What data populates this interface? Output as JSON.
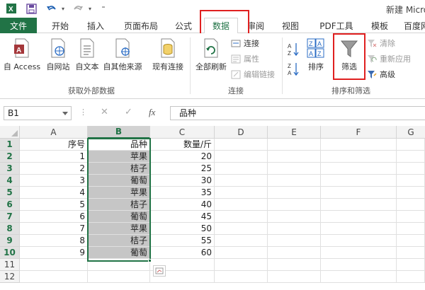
{
  "window": {
    "title": "新建 Micro"
  },
  "quick_access": {
    "save_icon": "save-icon",
    "undo_icon": "undo-icon",
    "redo_icon": "redo-icon"
  },
  "ribbon_tabs": [
    {
      "label": "文件"
    },
    {
      "label": "开始"
    },
    {
      "label": "插入"
    },
    {
      "label": "页面布局"
    },
    {
      "label": "公式"
    },
    {
      "label": "数据"
    },
    {
      "label": "审阅"
    },
    {
      "label": "视图"
    },
    {
      "label": "PDF工具"
    },
    {
      "label": "模板"
    },
    {
      "label": "百度网"
    }
  ],
  "active_tab": "数据",
  "ribbon": {
    "get_external": {
      "buttons": [
        "自 Access",
        "自网站",
        "自文本",
        "自其他来源",
        "现有连接"
      ],
      "label": "获取外部数据"
    },
    "connections": {
      "refresh_all": "全部刷新",
      "connections": "连接",
      "properties": "属性",
      "edit_links": "编辑链接",
      "label": "连接"
    },
    "sort_filter": {
      "sort": "排序",
      "filter": "筛选",
      "clear": "清除",
      "reapply": "重新应用",
      "advanced": "高级",
      "label": "排序和筛选"
    }
  },
  "formula_bar": {
    "name_box": "B1",
    "dots": "⋮",
    "cancel": "✕",
    "enter": "✓",
    "fx": "fx",
    "value": "品种"
  },
  "sheet": {
    "columns": [
      "A",
      "B",
      "C",
      "D",
      "E",
      "F",
      "G"
    ],
    "selected_column": "B",
    "rows": [
      {
        "n": "1",
        "a": "序号",
        "b": "品种",
        "c": "数量/斤"
      },
      {
        "n": "2",
        "a": "1",
        "b": "苹果",
        "c": "20"
      },
      {
        "n": "3",
        "a": "2",
        "b": "桔子",
        "c": "25"
      },
      {
        "n": "4",
        "a": "3",
        "b": "葡萄",
        "c": "30"
      },
      {
        "n": "5",
        "a": "4",
        "b": "苹果",
        "c": "35"
      },
      {
        "n": "6",
        "a": "5",
        "b": "桔子",
        "c": "40"
      },
      {
        "n": "7",
        "a": "6",
        "b": "葡萄",
        "c": "45"
      },
      {
        "n": "8",
        "a": "7",
        "b": "苹果",
        "c": "50"
      },
      {
        "n": "9",
        "a": "8",
        "b": "桔子",
        "c": "55"
      },
      {
        "n": "10",
        "a": "9",
        "b": "葡萄",
        "c": "60"
      },
      {
        "n": "11",
        "a": "",
        "b": "",
        "c": ""
      },
      {
        "n": "12",
        "a": "",
        "b": "",
        "c": ""
      }
    ]
  },
  "colors": {
    "accent": "#217346",
    "highlight": "#e02020",
    "selection": "#c6c6c6"
  }
}
